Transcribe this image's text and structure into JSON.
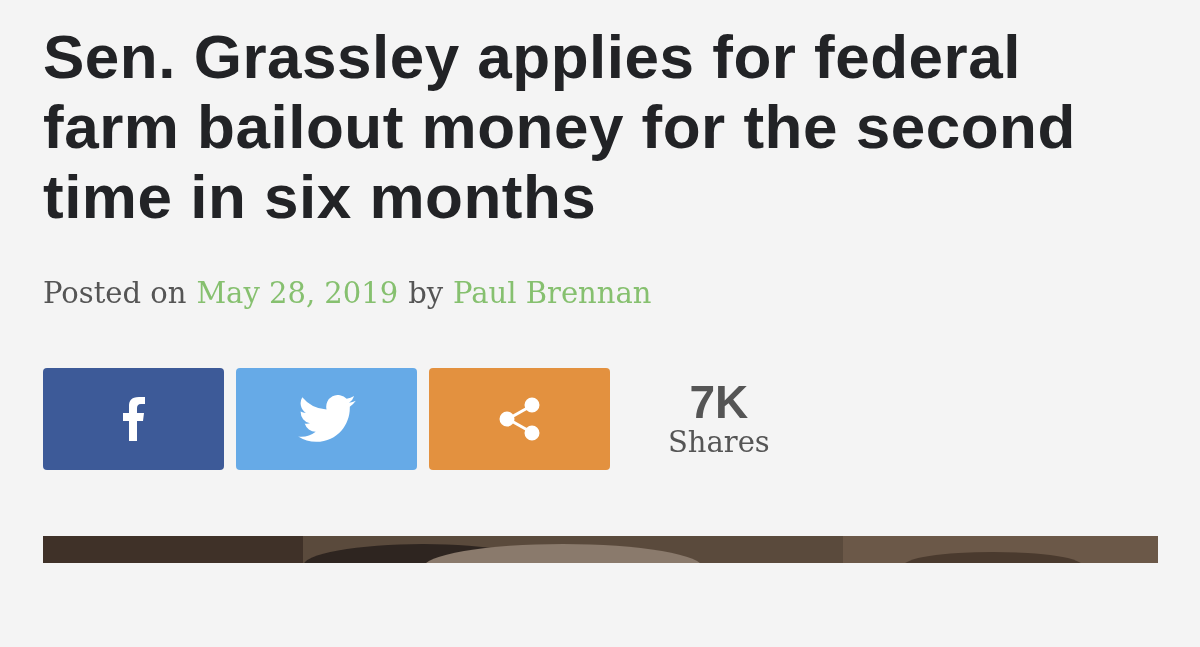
{
  "article": {
    "headline": "Sen. Grassley applies for federal farm bailout money for the second time in six months",
    "byline": {
      "prefix": "Posted on",
      "date": "May 28, 2019",
      "connector": "by",
      "author": "Paul Brennan"
    },
    "share_buttons": [
      {
        "kind": "facebook"
      },
      {
        "kind": "twitter"
      },
      {
        "kind": "share"
      }
    ],
    "share_count": {
      "value": "7K",
      "label": "Shares"
    }
  }
}
